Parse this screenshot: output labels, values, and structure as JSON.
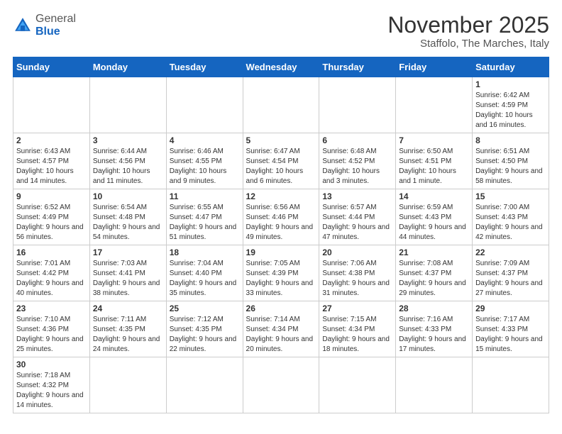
{
  "header": {
    "logo_line1": "General",
    "logo_line2": "Blue",
    "month": "November 2025",
    "location": "Staffolo, The Marches, Italy"
  },
  "weekdays": [
    "Sunday",
    "Monday",
    "Tuesday",
    "Wednesday",
    "Thursday",
    "Friday",
    "Saturday"
  ],
  "days": [
    {
      "num": "",
      "info": ""
    },
    {
      "num": "",
      "info": ""
    },
    {
      "num": "",
      "info": ""
    },
    {
      "num": "",
      "info": ""
    },
    {
      "num": "",
      "info": ""
    },
    {
      "num": "",
      "info": ""
    },
    {
      "num": "1",
      "info": "Sunrise: 6:42 AM\nSunset: 4:59 PM\nDaylight: 10 hours and 16 minutes."
    },
    {
      "num": "2",
      "info": "Sunrise: 6:43 AM\nSunset: 4:57 PM\nDaylight: 10 hours and 14 minutes."
    },
    {
      "num": "3",
      "info": "Sunrise: 6:44 AM\nSunset: 4:56 PM\nDaylight: 10 hours and 11 minutes."
    },
    {
      "num": "4",
      "info": "Sunrise: 6:46 AM\nSunset: 4:55 PM\nDaylight: 10 hours and 9 minutes."
    },
    {
      "num": "5",
      "info": "Sunrise: 6:47 AM\nSunset: 4:54 PM\nDaylight: 10 hours and 6 minutes."
    },
    {
      "num": "6",
      "info": "Sunrise: 6:48 AM\nSunset: 4:52 PM\nDaylight: 10 hours and 3 minutes."
    },
    {
      "num": "7",
      "info": "Sunrise: 6:50 AM\nSunset: 4:51 PM\nDaylight: 10 hours and 1 minute."
    },
    {
      "num": "8",
      "info": "Sunrise: 6:51 AM\nSunset: 4:50 PM\nDaylight: 9 hours and 58 minutes."
    },
    {
      "num": "9",
      "info": "Sunrise: 6:52 AM\nSunset: 4:49 PM\nDaylight: 9 hours and 56 minutes."
    },
    {
      "num": "10",
      "info": "Sunrise: 6:54 AM\nSunset: 4:48 PM\nDaylight: 9 hours and 54 minutes."
    },
    {
      "num": "11",
      "info": "Sunrise: 6:55 AM\nSunset: 4:47 PM\nDaylight: 9 hours and 51 minutes."
    },
    {
      "num": "12",
      "info": "Sunrise: 6:56 AM\nSunset: 4:46 PM\nDaylight: 9 hours and 49 minutes."
    },
    {
      "num": "13",
      "info": "Sunrise: 6:57 AM\nSunset: 4:44 PM\nDaylight: 9 hours and 47 minutes."
    },
    {
      "num": "14",
      "info": "Sunrise: 6:59 AM\nSunset: 4:43 PM\nDaylight: 9 hours and 44 minutes."
    },
    {
      "num": "15",
      "info": "Sunrise: 7:00 AM\nSunset: 4:43 PM\nDaylight: 9 hours and 42 minutes."
    },
    {
      "num": "16",
      "info": "Sunrise: 7:01 AM\nSunset: 4:42 PM\nDaylight: 9 hours and 40 minutes."
    },
    {
      "num": "17",
      "info": "Sunrise: 7:03 AM\nSunset: 4:41 PM\nDaylight: 9 hours and 38 minutes."
    },
    {
      "num": "18",
      "info": "Sunrise: 7:04 AM\nSunset: 4:40 PM\nDaylight: 9 hours and 35 minutes."
    },
    {
      "num": "19",
      "info": "Sunrise: 7:05 AM\nSunset: 4:39 PM\nDaylight: 9 hours and 33 minutes."
    },
    {
      "num": "20",
      "info": "Sunrise: 7:06 AM\nSunset: 4:38 PM\nDaylight: 9 hours and 31 minutes."
    },
    {
      "num": "21",
      "info": "Sunrise: 7:08 AM\nSunset: 4:37 PM\nDaylight: 9 hours and 29 minutes."
    },
    {
      "num": "22",
      "info": "Sunrise: 7:09 AM\nSunset: 4:37 PM\nDaylight: 9 hours and 27 minutes."
    },
    {
      "num": "23",
      "info": "Sunrise: 7:10 AM\nSunset: 4:36 PM\nDaylight: 9 hours and 25 minutes."
    },
    {
      "num": "24",
      "info": "Sunrise: 7:11 AM\nSunset: 4:35 PM\nDaylight: 9 hours and 24 minutes."
    },
    {
      "num": "25",
      "info": "Sunrise: 7:12 AM\nSunset: 4:35 PM\nDaylight: 9 hours and 22 minutes."
    },
    {
      "num": "26",
      "info": "Sunrise: 7:14 AM\nSunset: 4:34 PM\nDaylight: 9 hours and 20 minutes."
    },
    {
      "num": "27",
      "info": "Sunrise: 7:15 AM\nSunset: 4:34 PM\nDaylight: 9 hours and 18 minutes."
    },
    {
      "num": "28",
      "info": "Sunrise: 7:16 AM\nSunset: 4:33 PM\nDaylight: 9 hours and 17 minutes."
    },
    {
      "num": "29",
      "info": "Sunrise: 7:17 AM\nSunset: 4:33 PM\nDaylight: 9 hours and 15 minutes."
    },
    {
      "num": "30",
      "info": "Sunrise: 7:18 AM\nSunset: 4:32 PM\nDaylight: 9 hours and 14 minutes."
    },
    {
      "num": "",
      "info": ""
    },
    {
      "num": "",
      "info": ""
    },
    {
      "num": "",
      "info": ""
    },
    {
      "num": "",
      "info": ""
    },
    {
      "num": "",
      "info": ""
    },
    {
      "num": "",
      "info": ""
    }
  ]
}
